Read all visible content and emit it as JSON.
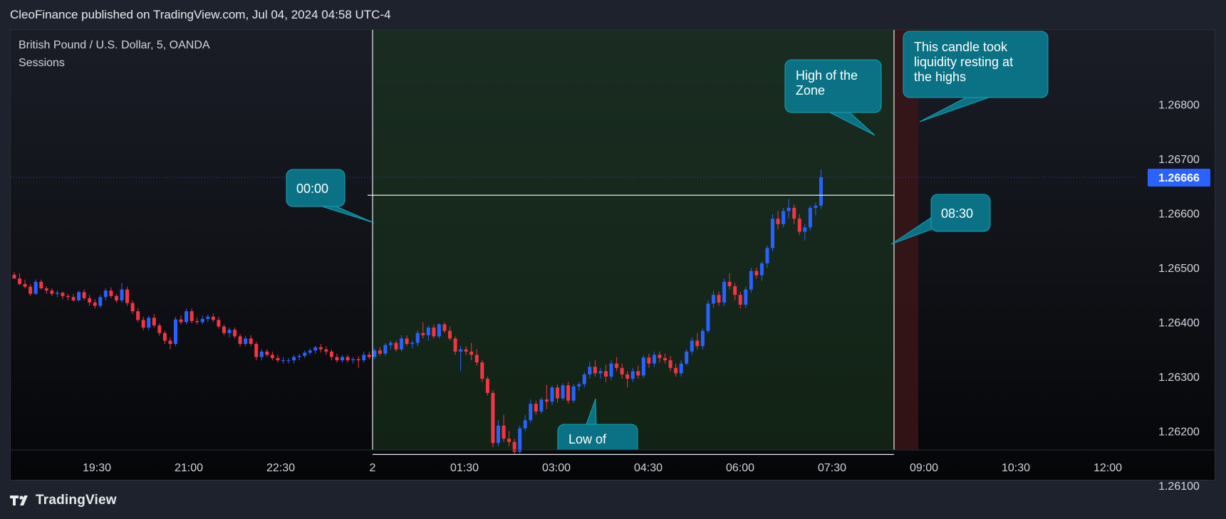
{
  "header": {
    "publisher_text": "CleoFinance published on TradingView.com, Jul 04, 2024 04:58 UTC-4"
  },
  "legend": {
    "instrument": "British Pound / U.S. Dollar, 5, OANDA",
    "indicator": "Sessions"
  },
  "footer": {
    "brand": "TradingView",
    "logo_icon": "tradingview-logo-icon"
  },
  "colors": {
    "up": "#2962ff",
    "down": "#f23645",
    "annotation_fill": "#0b7285",
    "price_badge": "#2962ff",
    "session_fill": "#1b3a1f",
    "highlight_column": "#3a1518"
  },
  "chart_data": {
    "type": "candlestick",
    "title": "",
    "x_ticks": [
      "19:30",
      "21:00",
      "22:30",
      "2",
      "01:30",
      "03:00",
      "04:30",
      "06:00",
      "07:30",
      "09:00",
      "10:30",
      "12:00"
    ],
    "y_ticks": [
      1.268,
      1.267,
      1.266,
      1.265,
      1.264,
      1.263,
      1.262,
      1.261
    ],
    "y_tick_labels": [
      "1.26800",
      "1.26700",
      "1.26600",
      "1.26500",
      "1.26400",
      "1.26300",
      "1.26200",
      "1.26100"
    ],
    "ylim": [
      1.2603,
      1.2691
    ],
    "current_price": 1.26666,
    "current_price_label": "1.26666",
    "zone": {
      "high": 1.26633,
      "low": 1.26157,
      "start_time": "00:00",
      "end_time": "08:30"
    },
    "annotations": [
      {
        "text": "00:00"
      },
      {
        "text": "08:30"
      },
      {
        "text": "High of the Zone"
      },
      {
        "text": "Low of"
      },
      {
        "text": "This candle took liquidity resting at the highs"
      }
    ],
    "candles": [
      [
        1.26487,
        1.26492,
        1.26482,
        1.2648
      ],
      [
        1.2648,
        1.2649,
        1.26468,
        1.2647
      ],
      [
        1.2647,
        1.26478,
        1.26462,
        1.26465
      ],
      [
        1.26465,
        1.2647,
        1.26448,
        1.26452
      ],
      [
        1.26452,
        1.26478,
        1.2645,
        1.26474
      ],
      [
        1.26474,
        1.26478,
        1.2646,
        1.26462
      ],
      [
        1.26462,
        1.26466,
        1.26452,
        1.26458
      ],
      [
        1.26458,
        1.26462,
        1.26448,
        1.26452
      ],
      [
        1.26452,
        1.26458,
        1.26446,
        1.26454
      ],
      [
        1.26454,
        1.26456,
        1.26442,
        1.26448
      ],
      [
        1.26448,
        1.26452,
        1.2644,
        1.26446
      ],
      [
        1.26446,
        1.26452,
        1.26438,
        1.2644
      ],
      [
        1.2644,
        1.26458,
        1.26438,
        1.26455
      ],
      [
        1.26455,
        1.2646,
        1.2644,
        1.26444
      ],
      [
        1.26444,
        1.2645,
        1.2643,
        1.26436
      ],
      [
        1.26436,
        1.26442,
        1.26425,
        1.2643
      ],
      [
        1.2643,
        1.2645,
        1.26426,
        1.26446
      ],
      [
        1.26446,
        1.26462,
        1.2644,
        1.26458
      ],
      [
        1.26458,
        1.26464,
        1.26444,
        1.26448
      ],
      [
        1.26448,
        1.26452,
        1.26436,
        1.2644
      ],
      [
        1.2644,
        1.26472,
        1.26436,
        1.2646
      ],
      [
        1.2646,
        1.26465,
        1.2643,
        1.26435
      ],
      [
        1.26435,
        1.2644,
        1.26415,
        1.2642
      ],
      [
        1.2642,
        1.26426,
        1.264,
        1.26404
      ],
      [
        1.26404,
        1.2641,
        1.26385,
        1.2639
      ],
      [
        1.2639,
        1.26412,
        1.26385,
        1.26408
      ],
      [
        1.26408,
        1.26415,
        1.2639,
        1.26394
      ],
      [
        1.26394,
        1.26398,
        1.26375,
        1.2638
      ],
      [
        1.2638,
        1.26384,
        1.2636,
        1.26366
      ],
      [
        1.26366,
        1.26372,
        1.2635,
        1.2636
      ],
      [
        1.2636,
        1.2641,
        1.26356,
        1.26405
      ],
      [
        1.26405,
        1.26412,
        1.26396,
        1.264
      ],
      [
        1.264,
        1.26425,
        1.26396,
        1.2642
      ],
      [
        1.2642,
        1.26425,
        1.26398,
        1.26402
      ],
      [
        1.26402,
        1.26408,
        1.26396,
        1.264
      ],
      [
        1.264,
        1.26412,
        1.26396,
        1.26406
      ],
      [
        1.26406,
        1.26414,
        1.264,
        1.2641
      ],
      [
        1.2641,
        1.26416,
        1.264,
        1.26404
      ],
      [
        1.26404,
        1.2641,
        1.26388,
        1.26392
      ],
      [
        1.26392,
        1.26396,
        1.26376,
        1.2638
      ],
      [
        1.2638,
        1.2639,
        1.26372,
        1.26386
      ],
      [
        1.26386,
        1.2639,
        1.2637,
        1.26374
      ],
      [
        1.26374,
        1.26378,
        1.26355,
        1.2636
      ],
      [
        1.2636,
        1.26375,
        1.26356,
        1.2637
      ],
      [
        1.2637,
        1.26376,
        1.26356,
        1.2636
      ],
      [
        1.2636,
        1.26364,
        1.2633,
        1.26336
      ],
      [
        1.26336,
        1.2635,
        1.2633,
        1.26346
      ],
      [
        1.26346,
        1.2635,
        1.26336,
        1.2634
      ],
      [
        1.2634,
        1.26346,
        1.2633,
        1.26334
      ],
      [
        1.26334,
        1.2634,
        1.26326,
        1.2633
      ],
      [
        1.2633,
        1.26336,
        1.26324,
        1.2633
      ],
      [
        1.2633,
        1.26334,
        1.26324,
        1.2633
      ],
      [
        1.2633,
        1.2634,
        1.26324,
        1.26336
      ],
      [
        1.26336,
        1.26342,
        1.2633,
        1.26338
      ],
      [
        1.26338,
        1.26348,
        1.26334,
        1.26344
      ],
      [
        1.26344,
        1.26352,
        1.2634,
        1.26348
      ],
      [
        1.26348,
        1.26356,
        1.26342,
        1.26354
      ],
      [
        1.26354,
        1.2636,
        1.26344,
        1.2635
      ],
      [
        1.2635,
        1.26356,
        1.2634,
        1.26346
      ],
      [
        1.26346,
        1.2635,
        1.2633,
        1.26336
      ],
      [
        1.26336,
        1.26342,
        1.26326,
        1.2633
      ],
      [
        1.2633,
        1.2634,
        1.26326,
        1.26336
      ],
      [
        1.26336,
        1.2634,
        1.26326,
        1.2633
      ],
      [
        1.2633,
        1.26336,
        1.26324,
        1.26332
      ],
      [
        1.26332,
        1.26338,
        1.26316,
        1.2633
      ],
      [
        1.2633,
        1.26346,
        1.26326,
        1.2634
      ],
      [
        1.2634,
        1.26346,
        1.26332,
        1.26336
      ],
      [
        1.26336,
        1.26352,
        1.26332,
        1.26348
      ],
      [
        1.26348,
        1.26354,
        1.26338,
        1.26342
      ],
      [
        1.26342,
        1.26362,
        1.26338,
        1.26358
      ],
      [
        1.26358,
        1.26366,
        1.2635,
        1.26362
      ],
      [
        1.26362,
        1.26366,
        1.26346,
        1.2635
      ],
      [
        1.2635,
        1.26376,
        1.26346,
        1.2637
      ],
      [
        1.2637,
        1.26376,
        1.26356,
        1.2636
      ],
      [
        1.2636,
        1.26366,
        1.26352,
        1.26362
      ],
      [
        1.26362,
        1.26385,
        1.26356,
        1.2638
      ],
      [
        1.2638,
        1.264,
        1.2637,
        1.26376
      ],
      [
        1.26376,
        1.26394,
        1.26366,
        1.2639
      ],
      [
        1.2639,
        1.26396,
        1.2637,
        1.26374
      ],
      [
        1.26374,
        1.26398,
        1.2637,
        1.26396
      ],
      [
        1.26396,
        1.264,
        1.2638,
        1.26384
      ],
      [
        1.26384,
        1.26392,
        1.26366,
        1.2637
      ],
      [
        1.2637,
        1.26374,
        1.2634,
        1.26346
      ],
      [
        1.26346,
        1.26356,
        1.2631,
        1.2635
      ],
      [
        1.2635,
        1.26356,
        1.2634,
        1.26346
      ],
      [
        1.26346,
        1.26362,
        1.2633,
        1.2634
      ],
      [
        1.2634,
        1.2635,
        1.2632,
        1.26326
      ],
      [
        1.26326,
        1.2633,
        1.2629,
        1.26296
      ],
      [
        1.26296,
        1.263,
        1.26265,
        1.2627
      ],
      [
        1.2627,
        1.26275,
        1.2617,
        1.26178
      ],
      [
        1.26178,
        1.2622,
        1.26172,
        1.2621
      ],
      [
        1.2621,
        1.2623,
        1.2618,
        1.26186
      ],
      [
        1.26186,
        1.262,
        1.26172,
        1.2618
      ],
      [
        1.2618,
        1.26186,
        1.26157,
        1.26162
      ],
      [
        1.26162,
        1.2621,
        1.26158,
        1.26205
      ],
      [
        1.26205,
        1.2623,
        1.262,
        1.2622
      ],
      [
        1.2622,
        1.26258,
        1.26215,
        1.2625
      ],
      [
        1.2625,
        1.26256,
        1.2623,
        1.26236
      ],
      [
        1.26236,
        1.26262,
        1.26232,
        1.26258
      ],
      [
        1.26258,
        1.26285,
        1.2624,
        1.26254
      ],
      [
        1.26254,
        1.26284,
        1.26248,
        1.2628
      ],
      [
        1.2628,
        1.26286,
        1.26252,
        1.2626
      ],
      [
        1.2626,
        1.26288,
        1.26256,
        1.26284
      ],
      [
        1.26284,
        1.2629,
        1.2625,
        1.26256
      ],
      [
        1.26256,
        1.26286,
        1.26252,
        1.26282
      ],
      [
        1.26282,
        1.2629,
        1.26274,
        1.26286
      ],
      [
        1.26286,
        1.26308,
        1.2628,
        1.26304
      ],
      [
        1.26304,
        1.26328,
        1.26296,
        1.26318
      ],
      [
        1.26318,
        1.2633,
        1.263,
        1.26306
      ],
      [
        1.26306,
        1.26316,
        1.26296,
        1.2631
      ],
      [
        1.2631,
        1.26322,
        1.2629,
        1.263
      ],
      [
        1.263,
        1.2633,
        1.26294,
        1.26324
      ],
      [
        1.26324,
        1.26336,
        1.2631,
        1.26316
      ],
      [
        1.26316,
        1.26324,
        1.26296,
        1.26304
      ],
      [
        1.26304,
        1.2631,
        1.2628,
        1.26296
      ],
      [
        1.26296,
        1.26316,
        1.2629,
        1.2631
      ],
      [
        1.2631,
        1.2632,
        1.26296,
        1.26302
      ],
      [
        1.26302,
        1.2634,
        1.26298,
        1.26335
      ],
      [
        1.26335,
        1.26342,
        1.26316,
        1.26324
      ],
      [
        1.26324,
        1.26346,
        1.26318,
        1.2634
      ],
      [
        1.2634,
        1.26346,
        1.26326,
        1.26334
      ],
      [
        1.26334,
        1.26342,
        1.26324,
        1.2633
      ],
      [
        1.2633,
        1.26338,
        1.2631,
        1.26316
      ],
      [
        1.26316,
        1.26324,
        1.263,
        1.26306
      ],
      [
        1.26306,
        1.2633,
        1.263,
        1.26324
      ],
      [
        1.26324,
        1.2635,
        1.2632,
        1.26346
      ],
      [
        1.26346,
        1.26372,
        1.2634,
        1.26366
      ],
      [
        1.26366,
        1.2638,
        1.2635,
        1.26356
      ],
      [
        1.26356,
        1.26388,
        1.2635,
        1.26384
      ],
      [
        1.26384,
        1.2644,
        1.2638,
        1.26434
      ],
      [
        1.26434,
        1.26458,
        1.26426,
        1.2645
      ],
      [
        1.2645,
        1.26456,
        1.2643,
        1.26436
      ],
      [
        1.26436,
        1.2648,
        1.2643,
        1.26474
      ],
      [
        1.26474,
        1.2649,
        1.2646,
        1.26466
      ],
      [
        1.26466,
        1.26472,
        1.2644,
        1.2645
      ],
      [
        1.2645,
        1.26456,
        1.26425,
        1.26432
      ],
      [
        1.26432,
        1.26466,
        1.26426,
        1.2646
      ],
      [
        1.2646,
        1.265,
        1.26454,
        1.26494
      ],
      [
        1.26494,
        1.265,
        1.2648,
        1.26486
      ],
      [
        1.26486,
        1.26512,
        1.26476,
        1.26508
      ],
      [
        1.26508,
        1.2654,
        1.265,
        1.26536
      ],
      [
        1.26536,
        1.26598,
        1.2653,
        1.2659
      ],
      [
        1.2659,
        1.26604,
        1.2657,
        1.2658
      ],
      [
        1.2658,
        1.2661,
        1.26574,
        1.26604
      ],
      [
        1.26604,
        1.26626,
        1.2659,
        1.2661
      ],
      [
        1.2661,
        1.26616,
        1.2658,
        1.2659
      ],
      [
        1.2659,
        1.26598,
        1.2656,
        1.26566
      ],
      [
        1.26566,
        1.2658,
        1.2655,
        1.26574
      ],
      [
        1.26574,
        1.26614,
        1.26568,
        1.2661
      ],
      [
        1.2661,
        1.2662,
        1.26596,
        1.26614
      ],
      [
        1.26614,
        1.2668,
        1.26608,
        1.26666
      ]
    ]
  }
}
